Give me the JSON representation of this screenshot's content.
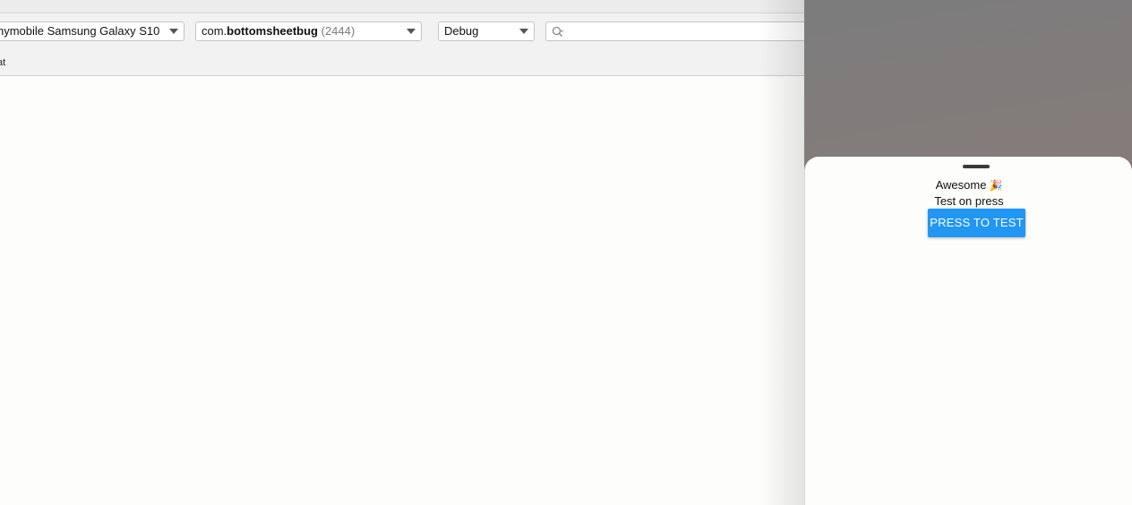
{
  "toolbar": {
    "device_label": "nymobile Samsung Galaxy S10",
    "process": {
      "package_prefix": "com.",
      "package_name": "bottomsheetbug",
      "pid": "(2444)"
    },
    "log_level": "Debug",
    "search_placeholder": "",
    "subrow_label": "at"
  },
  "sheet": {
    "title": "Awesome",
    "title_emoji": "🎉",
    "subtitle": "Test on press",
    "button_label": "PRESS TO TEST"
  },
  "colors": {
    "button_bg": "#2196f3",
    "backdrop": "#847c7a",
    "toolbar_bg": "#f2f2f2"
  }
}
